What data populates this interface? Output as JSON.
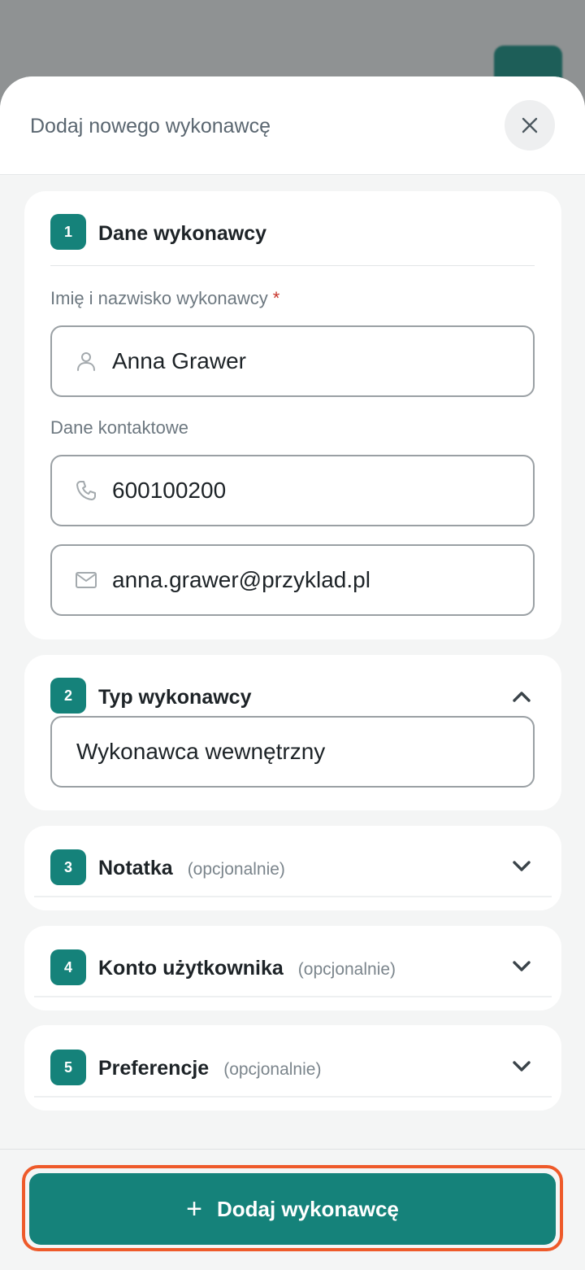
{
  "sheet": {
    "title": "Dodaj nowego wykonawcę",
    "close_icon": "close-icon"
  },
  "sections": [
    {
      "number": "1",
      "title": "Dane wykonawcy",
      "expanded": true,
      "fields": {
        "name_label": "Imię i nazwisko wykonawcy",
        "required_mark": "*",
        "name_value": "Anna Grawer",
        "contact_label": "Dane kontaktowe",
        "phone_value": "600100200",
        "email_value": "anna.grawer@przyklad.pl"
      }
    },
    {
      "number": "2",
      "title": "Typ wykonawcy",
      "expanded": true,
      "selected_value": "Wykonawca wewnętrzny"
    },
    {
      "number": "3",
      "title": "Notatka",
      "optional": "(opcjonalnie)",
      "expanded": false
    },
    {
      "number": "4",
      "title": "Konto użytkownika",
      "optional": "(opcjonalnie)",
      "expanded": false
    },
    {
      "number": "5",
      "title": "Preferencje",
      "optional": "(opcjonalnie)",
      "expanded": false
    }
  ],
  "footer": {
    "add_button_label": "Dodaj wykonawcę",
    "add_icon": "+"
  },
  "colors": {
    "accent": "#15827a",
    "highlight": "#ee5a2a",
    "required": "#c8352b"
  }
}
